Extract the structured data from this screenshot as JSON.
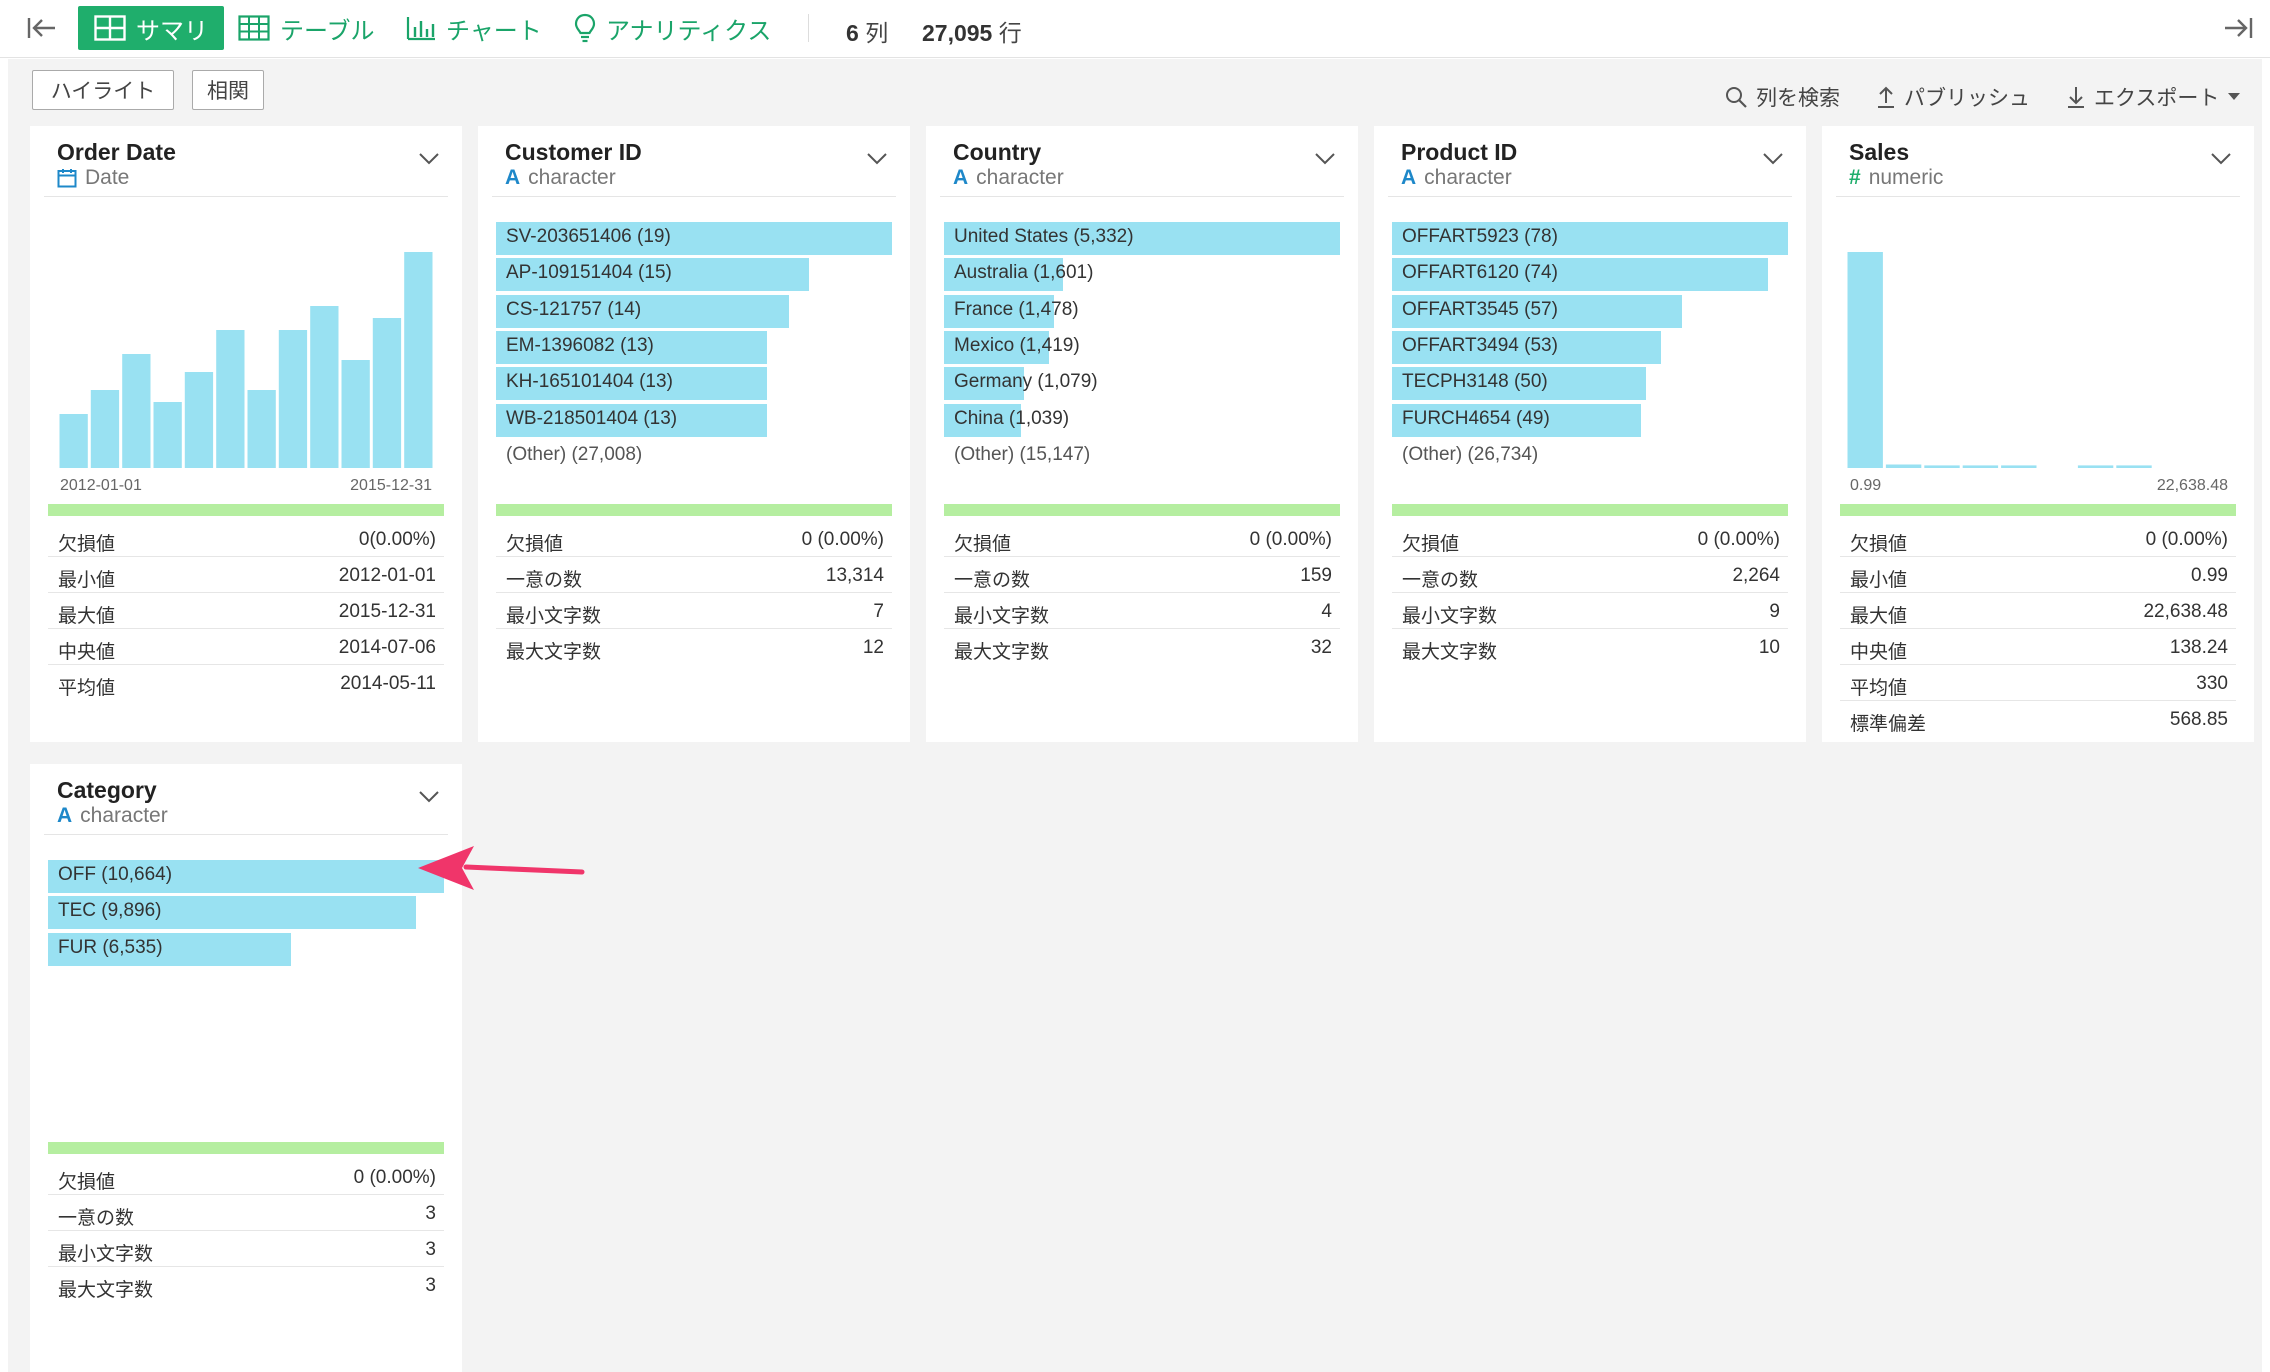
{
  "toolbar": {
    "tabs": [
      {
        "label": "サマリ",
        "icon": "grid-icon",
        "active": true
      },
      {
        "label": "テーブル",
        "icon": "table-icon"
      },
      {
        "label": "チャート",
        "icon": "bar-chart-icon"
      },
      {
        "label": "アナリティクス",
        "icon": "lightbulb-icon"
      }
    ],
    "col_count": "6",
    "col_unit": "列",
    "row_count": "27,095",
    "row_unit": "行"
  },
  "actions": {
    "highlight": "ハイライト",
    "correlation": "相関",
    "search_cols": "列を検索",
    "publish": "パブリッシュ",
    "export": "エクスポート"
  },
  "colors": {
    "accent": "#1fae6c",
    "bar": "#99e1f2",
    "valid": "#b5eea0",
    "arrow": "#f0356a"
  },
  "cards": [
    {
      "name": "Order Date",
      "type": "Date",
      "type_icon": "calendar-icon",
      "hist": {
        "values": [
          9,
          13,
          19,
          11,
          16,
          23,
          13,
          23,
          27,
          18,
          25,
          36
        ]
      },
      "axis_min": "2012-01-01",
      "axis_max": "2015-12-31",
      "stats": [
        {
          "k": "欠損値",
          "v": "0(0.00%)"
        },
        {
          "k": "最小値",
          "v": "2012-01-01"
        },
        {
          "k": "最大値",
          "v": "2015-12-31"
        },
        {
          "k": "中央値",
          "v": "2014-07-06"
        },
        {
          "k": "平均値",
          "v": "2014-05-11"
        }
      ]
    },
    {
      "name": "Customer ID",
      "type": "character",
      "type_icon": "A",
      "bars": [
        {
          "label": "SV-203651406 (19)",
          "frac": 1.0
        },
        {
          "label": "AP-109151404 (15)",
          "frac": 0.79
        },
        {
          "label": "CS-121757 (14)",
          "frac": 0.74
        },
        {
          "label": "EM-1396082 (13)",
          "frac": 0.685
        },
        {
          "label": "KH-165101404 (13)",
          "frac": 0.685
        },
        {
          "label": "WB-218501404 (13)",
          "frac": 0.685
        }
      ],
      "other": "(Other) (27,008)",
      "stats": [
        {
          "k": "欠損値",
          "v": "0 (0.00%)"
        },
        {
          "k": "一意の数",
          "v": "13,314"
        },
        {
          "k": "最小文字数",
          "v": "7"
        },
        {
          "k": "最大文字数",
          "v": "12"
        }
      ]
    },
    {
      "name": "Country",
      "type": "character",
      "type_icon": "A",
      "bars": [
        {
          "label": "United States (5,332)",
          "frac": 1.0
        },
        {
          "label": "Australia (1,601)",
          "frac": 0.3
        },
        {
          "label": "France (1,478)",
          "frac": 0.277
        },
        {
          "label": "Mexico (1,419)",
          "frac": 0.266
        },
        {
          "label": "Germany (1,079)",
          "frac": 0.202
        },
        {
          "label": "China (1,039)",
          "frac": 0.195
        }
      ],
      "other": "(Other) (15,147)",
      "stats": [
        {
          "k": "欠損値",
          "v": "0 (0.00%)"
        },
        {
          "k": "一意の数",
          "v": "159"
        },
        {
          "k": "最小文字数",
          "v": "4"
        },
        {
          "k": "最大文字数",
          "v": "32"
        }
      ]
    },
    {
      "name": "Product ID",
      "type": "character",
      "type_icon": "A",
      "bars": [
        {
          "label": "OFFART5923 (78)",
          "frac": 1.0
        },
        {
          "label": "OFFART6120 (74)",
          "frac": 0.949
        },
        {
          "label": "OFFART3545 (57)",
          "frac": 0.731
        },
        {
          "label": "OFFART3494 (53)",
          "frac": 0.68
        },
        {
          "label": "TECPH3148 (50)",
          "frac": 0.641
        },
        {
          "label": "FURCH4654 (49)",
          "frac": 0.628
        }
      ],
      "other": "(Other) (26,734)",
      "stats": [
        {
          "k": "欠損値",
          "v": "0 (0.00%)"
        },
        {
          "k": "一意の数",
          "v": "2,264"
        },
        {
          "k": "最小文字数",
          "v": "9"
        },
        {
          "k": "最大文字数",
          "v": "10"
        }
      ]
    },
    {
      "name": "Sales",
      "type": "numeric",
      "type_icon": "#",
      "hist": {
        "values": [
          100,
          1.6,
          1.2,
          1.2,
          1.2,
          0,
          1.2,
          1.2,
          0,
          0
        ]
      },
      "axis_min": "0.99",
      "axis_max": "22,638.48",
      "stats": [
        {
          "k": "欠損値",
          "v": "0 (0.00%)"
        },
        {
          "k": "最小値",
          "v": "0.99"
        },
        {
          "k": "最大値",
          "v": "22,638.48"
        },
        {
          "k": "中央値",
          "v": "138.24"
        },
        {
          "k": "平均値",
          "v": "330"
        },
        {
          "k": "標準偏差",
          "v": "568.85"
        }
      ]
    },
    {
      "name": "Category",
      "type": "character",
      "type_icon": "A",
      "bars": [
        {
          "label": "OFF (10,664)",
          "frac": 1.0
        },
        {
          "label": "TEC (9,896)",
          "frac": 0.928
        },
        {
          "label": "FUR (6,535)",
          "frac": 0.613
        }
      ],
      "other": "",
      "stats": [
        {
          "k": "欠損値",
          "v": "0 (0.00%)"
        },
        {
          "k": "一意の数",
          "v": "3"
        },
        {
          "k": "最小文字数",
          "v": "3"
        },
        {
          "k": "最大文字数",
          "v": "3"
        }
      ]
    }
  ]
}
